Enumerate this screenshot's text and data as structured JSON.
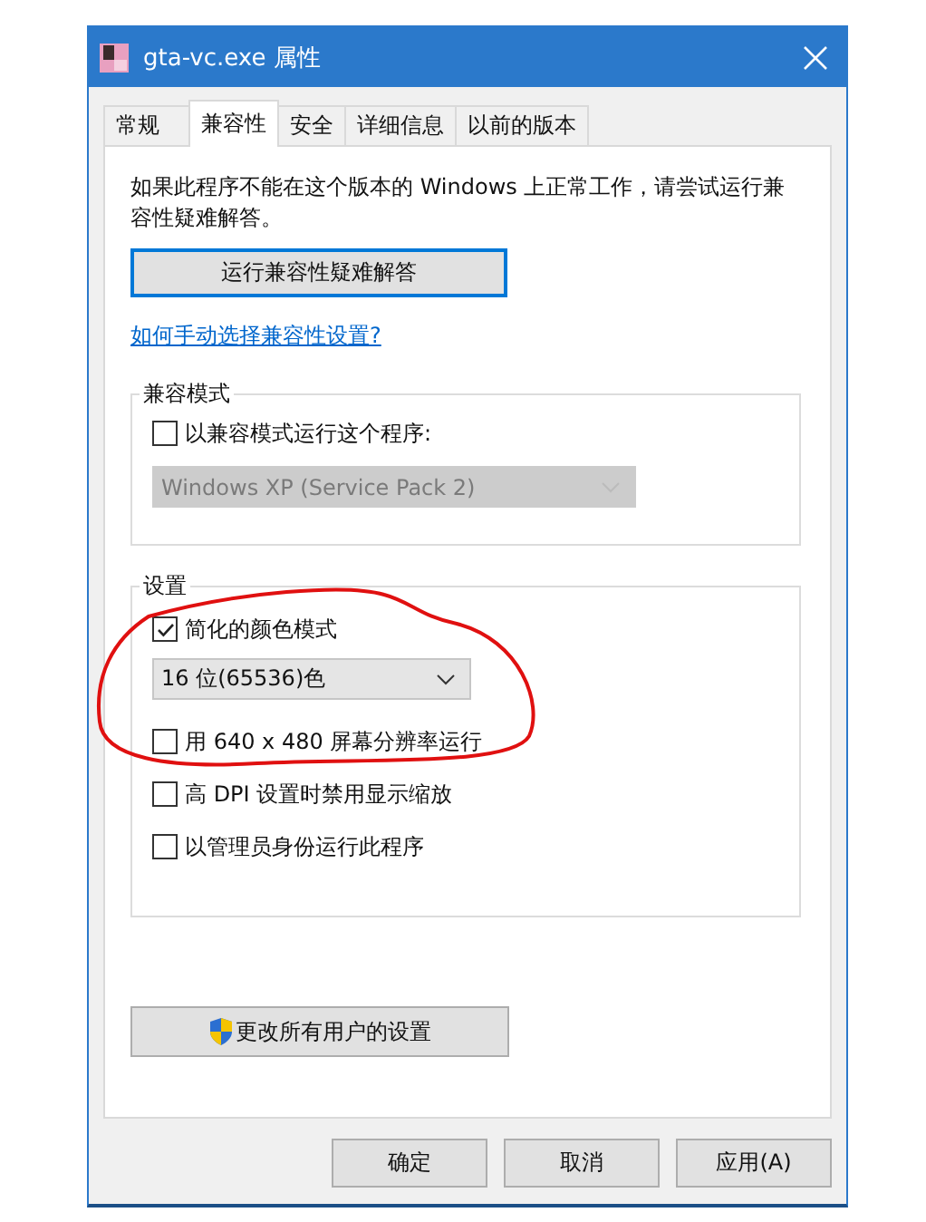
{
  "window": {
    "title": "gta-vc.exe 属性"
  },
  "tabs": [
    {
      "label": "常规",
      "selected": false
    },
    {
      "label": "兼容性",
      "selected": true
    },
    {
      "label": "安全",
      "selected": false
    },
    {
      "label": "详细信息",
      "selected": false
    },
    {
      "label": "以前的版本",
      "selected": false
    }
  ],
  "description": "如果此程序不能在这个版本的 Windows 上正常工作，请尝试运行兼容性疑难解答。",
  "troubleshoot_button": "运行兼容性疑难解答",
  "help_link": "如何手动选择兼容性设置?",
  "compat_mode": {
    "title": "兼容模式",
    "checkbox": {
      "label": "以兼容模式运行这个程序:",
      "checked": false
    },
    "dropdown": {
      "value": "Windows XP (Service Pack 2)",
      "disabled": true
    }
  },
  "settings": {
    "title": "设置",
    "items": [
      {
        "kind": "checkbox",
        "label": "简化的颜色模式",
        "checked": true
      },
      {
        "kind": "dropdown",
        "value": "16 位(65536)色",
        "disabled": false
      },
      {
        "kind": "checkbox",
        "label": "用 640 x 480 屏幕分辨率运行",
        "checked": false
      },
      {
        "kind": "checkbox",
        "label": "高 DPI 设置时禁用显示缩放",
        "checked": false
      },
      {
        "kind": "checkbox",
        "label": "以管理员身份运行此程序",
        "checked": false
      }
    ]
  },
  "all_users_button": "更改所有用户的设置",
  "buttons": [
    "确定",
    "取消",
    "应用(A)"
  ]
}
